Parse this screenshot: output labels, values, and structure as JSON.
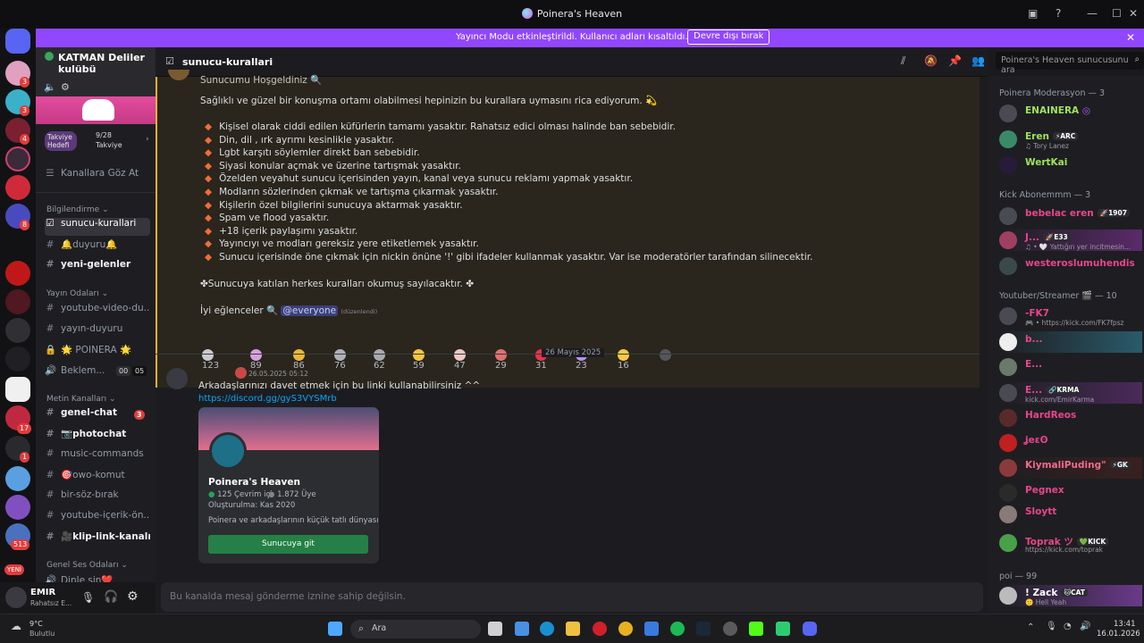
{
  "window": {
    "title": "Poinera's Heaven"
  },
  "banner": {
    "message": "Yayıncı Modu etkinleştirildi. Kullanıcı adları kısaltıldı.",
    "button": "Devre dışı bırak"
  },
  "guilds": {
    "badges": [
      "3",
      "3",
      "4",
      "8",
      "17",
      "1",
      "513",
      "1"
    ],
    "new_label": "YENİ"
  },
  "server": {
    "name": "KATMAN Deliler kulübü",
    "boost": {
      "goal_label": "Takviye Hedefi",
      "progress": "9/28",
      "progress_label": "Takviye"
    },
    "browse": "Kanallara Göz At",
    "categories": {
      "info": "Bilgilendirme",
      "stream": "Yayın Odaları",
      "text": "Metin Kanalları",
      "voice": "Genel Ses Odaları"
    },
    "channels": {
      "rules": "sunucu-kurallari",
      "news": "🔔duyuru🔔",
      "newcomers": "yeni-gelenler",
      "yt_video": "youtube-video-du...",
      "stream_news": "yayın-duyuru",
      "poinera": "🌟 POINERA 🌟",
      "waiting": "Beklem...",
      "waiting_a": "00",
      "waiting_b": "05",
      "general": "genel-chat",
      "general_badge": "3",
      "photo": "📷photochat",
      "music": "music-commands",
      "owo": "🎯owo-komut",
      "word": "bir-söz-bırak",
      "yt_content": "youtube-içerik-ön...",
      "clip": "🎥klip-link-kanalı",
      "voice_first": "Dinle sin❤️"
    }
  },
  "user": {
    "name": "EMIR",
    "status": "Rahatsız E..."
  },
  "channel_header": {
    "name": "sunucu-kurallari",
    "search_placeholder": "Poinera's Heaven sunucusunu ara"
  },
  "rules_message": {
    "top": "Sunucumu Hoşgeldiniz 🔍",
    "intro": "Sağlıklı ve güzel bir konuşma ortamı olabilmesi hepinizin bu kurallara uymasını rica ediyorum. 💫",
    "rules": [
      "Kişisel olarak ciddi edilen küfürlerin tamamı yasaktır. Rahatsız edici olması halinde ban sebebidir.",
      "Din, dil , ırk ayrımı kesinlikle yasaktır.",
      "Lgbt karşıtı söylemler direkt ban sebebidir.",
      "Siyasi konular açmak ve üzerine tartışmak yasaktır.",
      "Özelden veyahut sunucu içerisinden yayın, kanal veya sunucu reklamı yapmak yasaktır.",
      "Modların sözlerinden çıkmak ve tartışma çıkarmak yasaktır.",
      "Kişilerin özel bilgilerini sunucuya aktarmak yasaktır.",
      "Spam ve flood yasaktır.",
      "+18 içerik paylaşımı yasaktır.",
      "Yayıncıyı ve modları gereksiz yere etiketlemek yasaktır.",
      "Sunucu içerisinde öne çıkmak için nickin önüne '!' gibi ifadeler kullanmak yasaktır. Var ise moderatörler tarafından silinecektir."
    ],
    "accept": "✤Sunucuya katılan herkes kuralları okumuş sayılacaktır. ✤",
    "closing": "İyi eğlenceler 🔍",
    "mention": "@everyone",
    "edited": "(düzenlendi)",
    "reactions": [
      {
        "count": "123",
        "color": "#c9c9d1"
      },
      {
        "count": "89",
        "color": "#d8a0e0"
      },
      {
        "count": "86",
        "color": "#e8b838"
      },
      {
        "count": "76",
        "color": "#b0b0b8"
      },
      {
        "count": "62",
        "color": "#a8a8b0"
      },
      {
        "count": "59",
        "color": "#f4c542"
      },
      {
        "count": "47",
        "color": "#f0c8c8"
      },
      {
        "count": "29",
        "color": "#e07070"
      },
      {
        "count": "31",
        "color": "#e8334a"
      },
      {
        "count": "23",
        "color": "#b693f0"
      },
      {
        "count": "16",
        "color": "#f7c948"
      }
    ]
  },
  "date_separator": "26 Mayıs 2025",
  "invite_message": {
    "timestamp": "26.05.2025 05:12",
    "text": "Arkadaşlarınızı davet etmek için bu linki kullanabilirsiniz ^^",
    "link": "https://discord.gg/gyS3VYSMrb",
    "card": {
      "name": "Poinera's Heaven",
      "online": "125 Çevrim içi",
      "members": "1.872 Üye",
      "created": "Oluşturulma: Kas 2020",
      "description": "Poinera ve arkadaşlarının küçük tatlı dünyası",
      "button": "Sunucuya git"
    }
  },
  "composer": {
    "placeholder": "Bu kanalda mesaj gönderme iznine sahip değilsin."
  },
  "members": {
    "groups": [
      {
        "title": "Poinera Moderasyon — 3",
        "items": [
          {
            "name": "ENAINERA",
            "color": "#9ee35a",
            "tag": "",
            "status": ""
          },
          {
            "name": "Eren",
            "color": "#9ee35a",
            "tag": "⚡ARC",
            "status": "♫ Tory Lanez"
          },
          {
            "name": "WertKai",
            "color": "#9ee35a",
            "tag": "",
            "status": ""
          }
        ]
      },
      {
        "title": "Kick Abonemmm — 3",
        "items": [
          {
            "name": "bebelac eren",
            "color": "#e8458c",
            "tag": "🚀1907",
            "status": ""
          },
          {
            "name": "J...",
            "color": "#e8458c",
            "tag": "🚀E33",
            "status": "♫ • 🤍 Yattığın yer incitmesin..."
          },
          {
            "name": "westeroslumuhendis",
            "color": "#e8458c",
            "tag": "",
            "status": ""
          }
        ]
      },
      {
        "title": "Youtuber/Streamer 🎬 — 10",
        "items": [
          {
            "name": "-FK7",
            "color": "#e8458c",
            "tag": "",
            "status": "🎮 • https://kick.com/FK7fpsz"
          },
          {
            "name": "b...",
            "color": "#e8458c",
            "tag": "",
            "status": ""
          },
          {
            "name": "E...",
            "color": "#e8458c",
            "tag": "",
            "status": ""
          },
          {
            "name": "E...",
            "color": "#e8458c",
            "tag": "🔗KRMA",
            "status": "kick.com/EmirKarma"
          },
          {
            "name": "HardReos",
            "color": "#e8458c",
            "tag": "",
            "status": ""
          },
          {
            "name": "ʝeɛʘ",
            "color": "#e8458c",
            "tag": "",
            "status": ""
          },
          {
            "name": "Kiymali̇Puding\"",
            "color": "#e8458c",
            "tag": "⚡GK",
            "status": ""
          },
          {
            "name": "Pegnex",
            "color": "#e8458c",
            "tag": "",
            "status": ""
          },
          {
            "name": "Sloytt",
            "color": "#e8458c",
            "tag": "",
            "status": ""
          },
          {
            "name": "Toprak ツ",
            "color": "#e8458c",
            "tag": "💚KICK",
            "status": "https://kick.com/toprak"
          }
        ]
      },
      {
        "title": "poi — 99",
        "items": [
          {
            "name": "! Zack",
            "color": "#ffffff",
            "tag": "🐱CAT",
            "status": "🙂 Hell Yeah"
          }
        ]
      }
    ]
  },
  "taskbar": {
    "weather_temp": "9°C",
    "weather_desc": "Bulutlu",
    "search": "Ara",
    "time": "13:41",
    "date": "16.01.2026"
  }
}
